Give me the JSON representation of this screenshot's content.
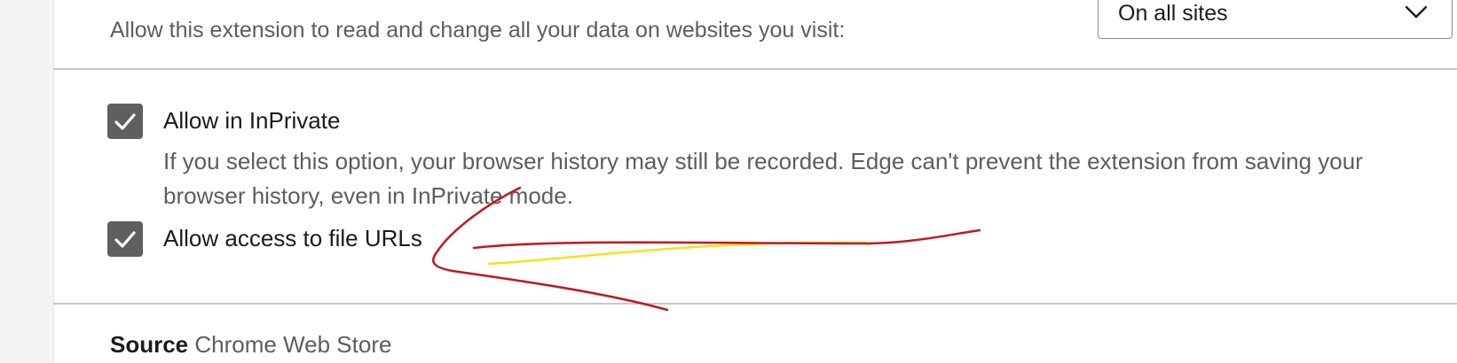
{
  "site_access": {
    "description": "Allow this extension to read and change all your data on websites you visit:",
    "selected_option": "On all sites"
  },
  "options": {
    "inprivate": {
      "label": "Allow in InPrivate",
      "checked": true,
      "description": "If you select this option, your browser history may still be recorded. Edge can't prevent the extension from saving your browser history, even in InPrivate mode."
    },
    "file_urls": {
      "label": "Allow access to file URLs",
      "checked": true
    }
  },
  "source": {
    "key": "Source",
    "value": "Chrome Web Store"
  },
  "icons": {
    "checkbox_check": "checkmark-icon",
    "dropdown": "chevron-down-icon"
  },
  "colors": {
    "checkbox_fill": "#5f5f5f",
    "annotation_red": "#c0181e",
    "annotation_yellow": "#f2e21a"
  }
}
